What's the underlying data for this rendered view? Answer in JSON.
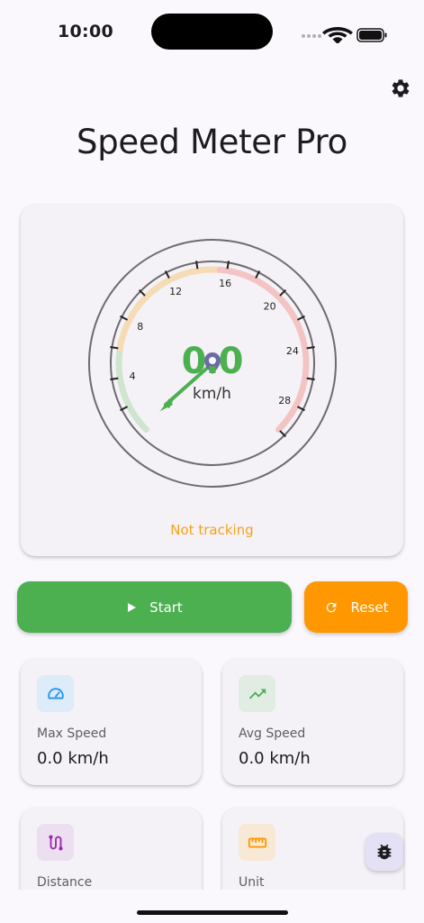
{
  "status_bar": {
    "time": "10:00"
  },
  "app": {
    "title": "Speed Meter Pro"
  },
  "gauge": {
    "value": "0.0",
    "unit": "km/h",
    "status": "Not tracking",
    "tick_labels": [
      "4",
      "8",
      "12",
      "16",
      "20",
      "24",
      "28"
    ]
  },
  "buttons": {
    "start": "Start",
    "reset": "Reset"
  },
  "stats": [
    {
      "label": "Max Speed",
      "value": "0.0 km/h",
      "icon": "speedometer-icon",
      "color": "#2196f3"
    },
    {
      "label": "Avg Speed",
      "value": "0.0 km/h",
      "icon": "trending-up-icon",
      "color": "#4caf50"
    },
    {
      "label": "Distance",
      "value": "",
      "icon": "route-icon",
      "color": "#9c27b0"
    },
    {
      "label": "Unit",
      "value": "",
      "icon": "ruler-icon",
      "color": "#ff9800"
    }
  ],
  "colors": {
    "green": "#4caf50",
    "orange": "#ff9800",
    "blue": "#2196f3",
    "purple": "#9c27b0",
    "status_orange": "#f4a21a"
  }
}
